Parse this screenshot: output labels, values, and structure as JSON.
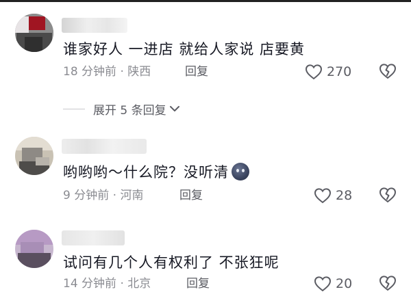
{
  "colors": {
    "text_primary": "#161823",
    "text_meta": "#8a8b91",
    "text_action": "#5b5c63",
    "icon": "#5b5c63"
  },
  "comments": [
    {
      "text": "谁家好人  一进店 就给人家说  店要黄",
      "time": "18 分钟前",
      "location": "陕西",
      "reply_label": "回复",
      "likes": "270",
      "icons": [
        "heart-icon",
        "broken-heart-icon"
      ]
    },
    {
      "text": "哟哟哟～什么院？没听清",
      "emoji": "blue-face-emoji",
      "time": "9 分钟前",
      "location": "河南",
      "reply_label": "回复",
      "likes": "28",
      "icons": [
        "heart-icon",
        "broken-heart-icon"
      ]
    },
    {
      "text": "试问有几个人有权利了 不张狂呢",
      "time": "14 分钟前",
      "location": "北京",
      "reply_label": "回复",
      "likes": "20",
      "icons": [
        "heart-icon",
        "broken-heart-icon"
      ]
    }
  ],
  "expand_replies": {
    "label": "展开 5 条回复",
    "icon": "chevron-down-icon"
  }
}
